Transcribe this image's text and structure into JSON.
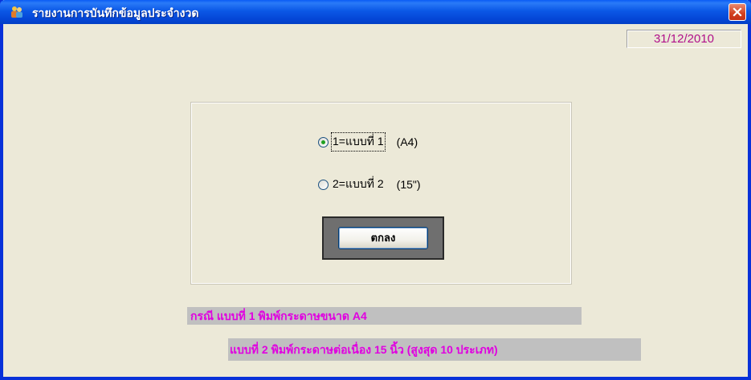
{
  "window": {
    "title": "รายงานการบันทึกข้อมูลประจำงวด",
    "icon": "app-people-icon",
    "close_icon": "close-icon"
  },
  "date_field": {
    "value": "31/12/2010"
  },
  "print_options": {
    "options": [
      {
        "label": "1=แบบที่ 1",
        "size": "(A4)",
        "selected": true
      },
      {
        "label": "2=แบบที่ 2",
        "size": "(15\")",
        "selected": false
      }
    ],
    "ok_label": "ตกลง"
  },
  "notes": {
    "line1": "กรณี แบบที่ 1 พิมพ์กระดาษขนาด A4",
    "line2": "แบบที่ 2 พิมพ์กระดาษต่อเนื่อง 15 นิ้ว (สูงสุด 10 ประเภท)"
  },
  "colors": {
    "titlebar": "#0446d6",
    "date_text": "#b0108a",
    "note_text": "#e000e0",
    "note_bg": "#c0c0c0",
    "radio_dot": "#21a121"
  }
}
